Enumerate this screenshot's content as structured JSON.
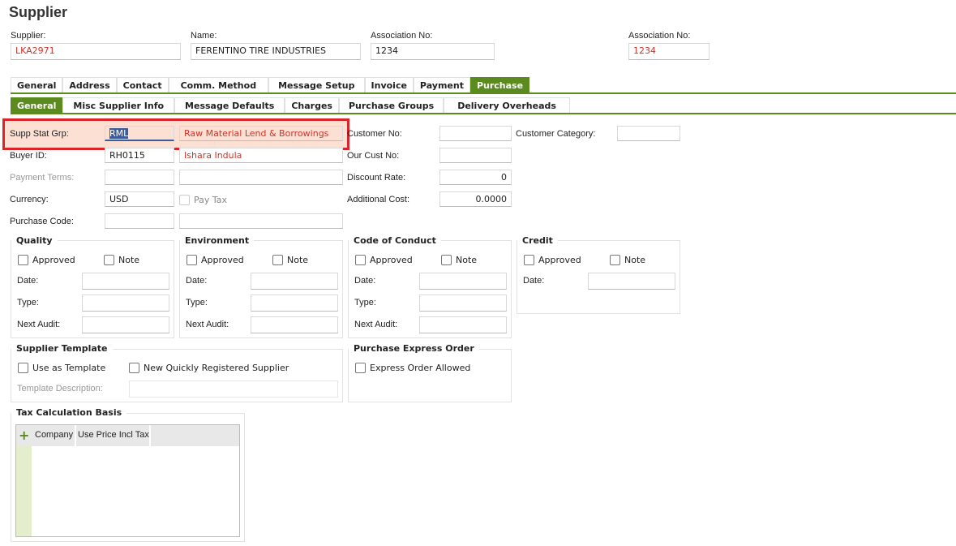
{
  "title": "Supplier",
  "header": {
    "supplier": {
      "label": "Supplier:",
      "value": "LKA2971"
    },
    "name": {
      "label": "Name:",
      "value": "FERENTINO TIRE INDUSTRIES"
    },
    "association1": {
      "label": "Association No:",
      "value": "1234"
    },
    "association2": {
      "label": "Association No:",
      "value": "1234"
    }
  },
  "tabs": [
    "General",
    "Address",
    "Contact",
    "Comm. Method",
    "Message Setup",
    "Invoice",
    "Payment",
    "Purchase"
  ],
  "subtabs": [
    "General",
    "Misc Supplier Info",
    "Message Defaults",
    "Charges",
    "Purchase Groups",
    "Delivery Overheads"
  ],
  "form": {
    "supp_stat_grp": {
      "label": "Supp Stat Grp:",
      "code": "RML",
      "desc": "Raw Material Lend & Borrowings"
    },
    "buyer_id": {
      "label": "Buyer ID:",
      "code": "RH0115",
      "desc": "Ishara Indula"
    },
    "payment_terms": {
      "label": "Payment Terms:"
    },
    "currency": {
      "label": "Currency:",
      "code": "USD",
      "pay_tax": "Pay Tax"
    },
    "purchase_code": {
      "label": "Purchase Code:"
    },
    "customer_no": {
      "label": "Customer No:"
    },
    "our_cust_no": {
      "label": "Our Cust No:"
    },
    "discount_rate": {
      "label": "Discount Rate:",
      "value": "0"
    },
    "additional_cost": {
      "label": "Additional Cost:",
      "value": "0.0000"
    },
    "customer_category": {
      "label": "Customer Category:"
    }
  },
  "groups": {
    "approved": "Approved",
    "note": "Note",
    "date": "Date:",
    "type": "Type:",
    "next_audit": "Next Audit:",
    "quality": "Quality",
    "environment": "Environment",
    "conduct": "Code of Conduct",
    "credit": "Credit"
  },
  "template": {
    "title": "Supplier Template",
    "use_as_template": "Use as Template",
    "new_quick": "New Quickly Registered Supplier",
    "desc_label": "Template Description:"
  },
  "express": {
    "title": "Purchase Express Order",
    "allowed": "Express Order Allowed"
  },
  "tax": {
    "title": "Tax Calculation Basis",
    "columns": [
      "Company",
      "Use Price Incl Tax"
    ]
  },
  "colors": {
    "accent": "#5b8a1e",
    "highlight": "#d9252a",
    "error_text": "#d0332a"
  }
}
